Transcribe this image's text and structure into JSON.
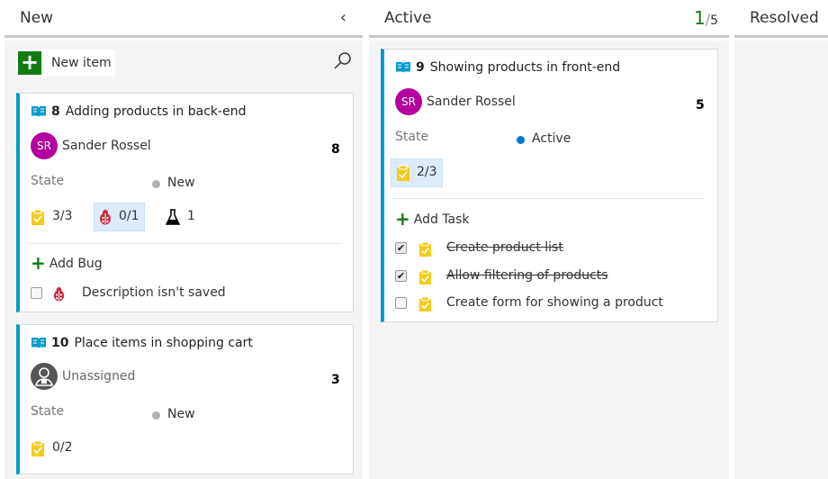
{
  "columns": {
    "new": {
      "title": "New",
      "collapse_icon": "chevron-left-icon"
    },
    "active": {
      "title": "Active",
      "wip_current": "1",
      "wip_sep": "/",
      "wip_limit": "5"
    },
    "resolved": {
      "title": "Resolved"
    }
  },
  "toolbar": {
    "new_item_label": "New item",
    "search_icon": "search-icon"
  },
  "cards": [
    {
      "id": "8",
      "title": "Adding products in back-end",
      "assignee": {
        "initials": "SR",
        "name": "Sander Rossel"
      },
      "effort": "8",
      "state_label": "State",
      "state": "New",
      "state_color": "#b2b2b2",
      "tasks": "3/3",
      "bugs": "0/1",
      "tests": "1",
      "add_label": "Add Bug",
      "children": [
        {
          "text": "Description isn't saved",
          "done": false
        }
      ]
    },
    {
      "id": "10",
      "title": "Place items in shopping cart",
      "assignee": {
        "initials": "",
        "name": "Unassigned"
      },
      "effort": "3",
      "state_label": "State",
      "state": "New",
      "state_color": "#b2b2b2",
      "tasks": "0/2"
    },
    {
      "id": "9",
      "title": "Showing products in front-end",
      "assignee": {
        "initials": "SR",
        "name": "Sander Rossel"
      },
      "effort": "5",
      "state_label": "State",
      "state": "Active",
      "state_color": "#007acc",
      "tasks": "2/3",
      "add_label": "Add Task",
      "children": [
        {
          "text": "Create product list",
          "done": true
        },
        {
          "text": "Allow filtering of products",
          "done": true
        },
        {
          "text": "Create form for showing a product",
          "done": false
        }
      ]
    }
  ],
  "colors": {
    "accent": "#009ccc",
    "add_green": "#107c10",
    "avatar": "#b4009e",
    "task_yellow": "#f2cb1d",
    "bug_red": "#cc293d"
  }
}
